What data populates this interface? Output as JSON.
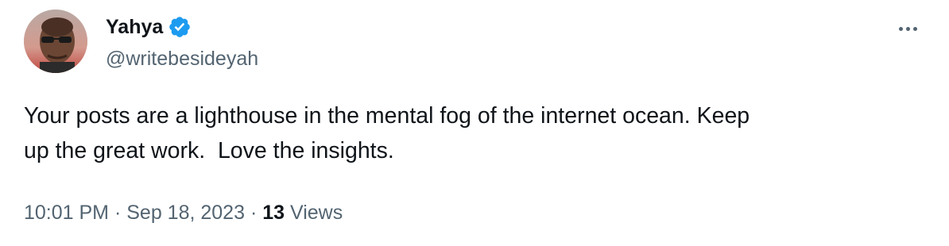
{
  "author": {
    "display_name": "Yahya",
    "handle": "@writebesideyah",
    "verified": true,
    "verified_color": "#1d9bf0"
  },
  "tweet": {
    "text_line1": "Your posts are a lighthouse in the mental fog of the internet ocean. Keep",
    "text_line2": "up the great work.  Love the insights."
  },
  "meta": {
    "time": "10:01 PM",
    "separator": "·",
    "date": "Sep 18, 2023",
    "views_count": "13",
    "views_label": "Views"
  },
  "icons": {
    "more": "more-options-icon",
    "verified": "verified-badge-icon"
  }
}
